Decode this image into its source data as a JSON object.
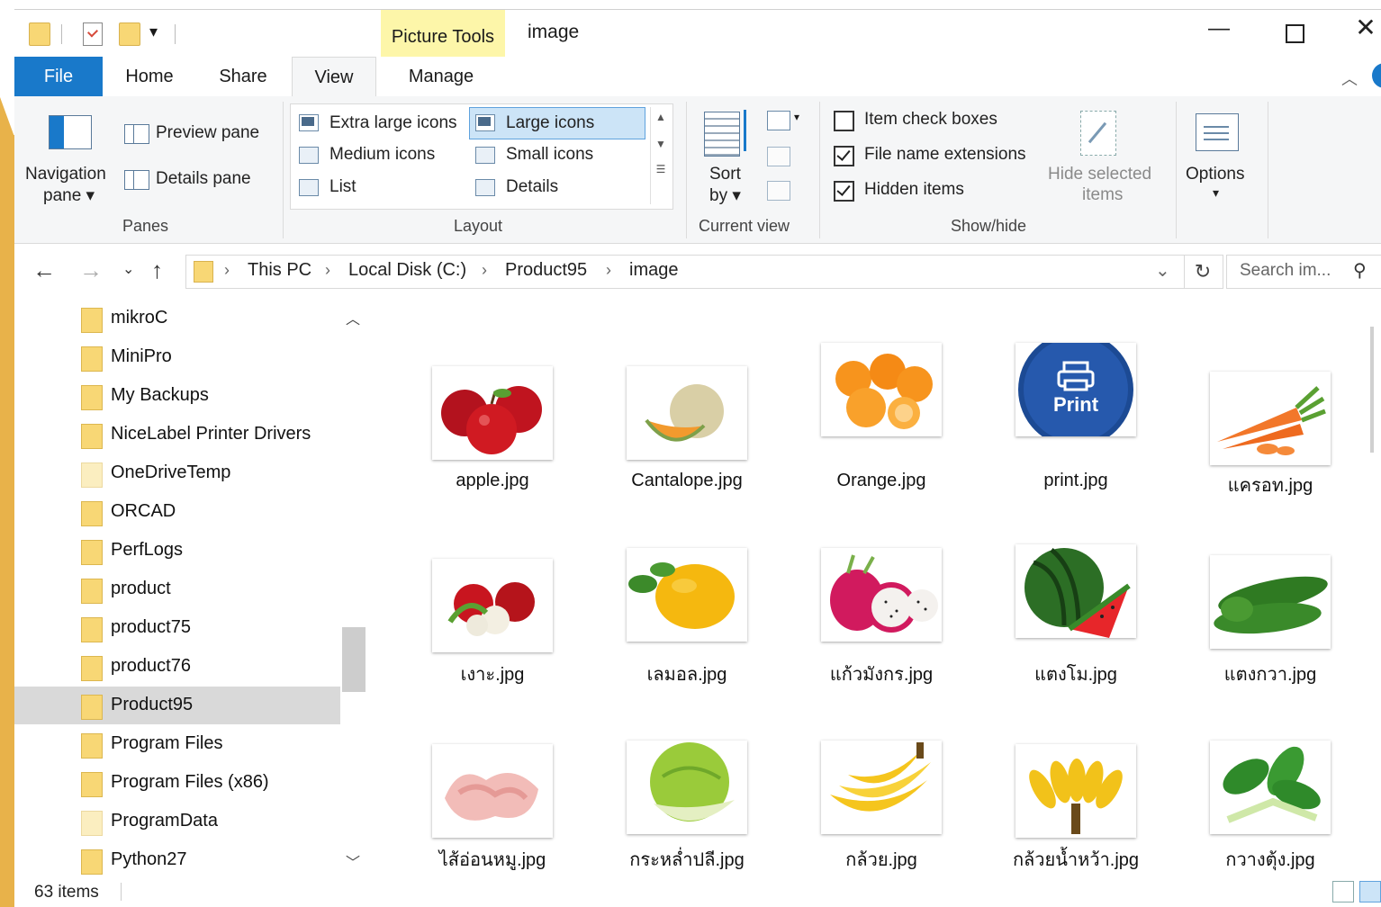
{
  "window": {
    "title": "image",
    "contextual_tab": "Picture Tools",
    "controls": {
      "minimize": "—",
      "maximize": "☐",
      "close": "✕"
    }
  },
  "tabs": {
    "file": "File",
    "home": "Home",
    "share": "Share",
    "view": "View",
    "manage": "Manage",
    "active": "View"
  },
  "ribbon": {
    "panes": {
      "navigation_pane_line1": "Navigation",
      "navigation_pane_line2": "pane ▾",
      "preview_pane": "Preview pane",
      "details_pane": "Details pane",
      "group_label": "Panes"
    },
    "layout": {
      "items": [
        "Extra large icons",
        "Large icons",
        "Medium icons",
        "Small icons",
        "List",
        "Details"
      ],
      "selected": "Large icons",
      "group_label": "Layout"
    },
    "current_view": {
      "sort_line1": "Sort",
      "sort_line2": "by ▾",
      "group_label": "Current view"
    },
    "show_hide": {
      "item_check_boxes": {
        "label": "Item check boxes",
        "checked": false
      },
      "file_name_extensions": {
        "label": "File name extensions",
        "checked": true
      },
      "hidden_items": {
        "label": "Hidden items",
        "checked": true
      },
      "hide_selected_line1": "Hide selected",
      "hide_selected_line2": "items",
      "group_label": "Show/hide"
    },
    "options": {
      "label": "Options",
      "arrow": "▾"
    }
  },
  "address": {
    "breadcrumb": [
      "This PC",
      "Local Disk (C:)",
      "Product95",
      "image"
    ],
    "separator": "›",
    "search_placeholder": "Search im..."
  },
  "nav": {
    "items": [
      {
        "label": "mikroC",
        "pale": false
      },
      {
        "label": "MiniPro",
        "pale": false
      },
      {
        "label": "My Backups",
        "pale": false
      },
      {
        "label": "NiceLabel Printer Drivers",
        "pale": false
      },
      {
        "label": "OneDriveTemp",
        "pale": true
      },
      {
        "label": "ORCAD",
        "pale": false
      },
      {
        "label": "PerfLogs",
        "pale": false
      },
      {
        "label": "product",
        "pale": false
      },
      {
        "label": "product75",
        "pale": false
      },
      {
        "label": "product76",
        "pale": false
      },
      {
        "label": "Product95",
        "pale": false
      },
      {
        "label": "Program Files",
        "pale": false
      },
      {
        "label": "Program Files (x86)",
        "pale": false
      },
      {
        "label": "ProgramData",
        "pale": true
      },
      {
        "label": "Python27",
        "pale": false
      }
    ],
    "selected": "Product95"
  },
  "files": [
    {
      "name": "apple.jpg",
      "icon": "apple-image"
    },
    {
      "name": "Cantalope.jpg",
      "icon": "cantaloupe-image"
    },
    {
      "name": "Orange.jpg",
      "icon": "orange-image"
    },
    {
      "name": "print.jpg",
      "icon": "print-button-image",
      "print_label": "Print"
    },
    {
      "name": "แครอท.jpg",
      "icon": "carrot-image"
    },
    {
      "name": "เงาะ.jpg",
      "icon": "rambutan-image"
    },
    {
      "name": "เลมอล.jpg",
      "icon": "lemon-image"
    },
    {
      "name": "แก้วมังกร.jpg",
      "icon": "dragonfruit-image"
    },
    {
      "name": "แตงโม.jpg",
      "icon": "watermelon-image"
    },
    {
      "name": "แตงกวา.jpg",
      "icon": "cucumber-image"
    },
    {
      "name": "ไส้อ่อนหมู.jpg",
      "icon": "pork-intestine-image"
    },
    {
      "name": "กระหล่ำปลี.jpg",
      "icon": "cabbage-image"
    },
    {
      "name": "กล้วย.jpg",
      "icon": "banana-image"
    },
    {
      "name": "กล้วยน้ำหว้า.jpg",
      "icon": "banana-bunch-image"
    },
    {
      "name": "กวางตุ้ง.jpg",
      "icon": "bok-choy-image"
    }
  ],
  "status": {
    "count": "63 items"
  },
  "colors": {
    "accent": "#1979ca",
    "folder": "#f8d775",
    "picture_tools": "#fdf6a9",
    "selection": "#cce4f7"
  }
}
